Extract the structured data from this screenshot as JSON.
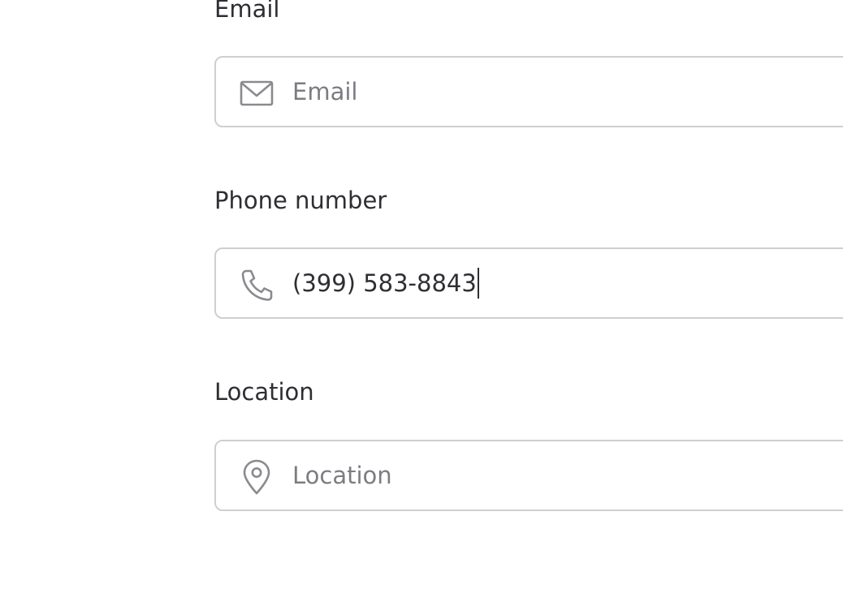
{
  "fields": {
    "email": {
      "label": "Email",
      "placeholder": "Email",
      "icon": "mail-icon"
    },
    "phone": {
      "label": "Phone number",
      "value": "(399) 583-8843",
      "icon": "phone-icon"
    },
    "location": {
      "label": "Location",
      "placeholder": "Location",
      "icon": "map-pin-icon"
    }
  }
}
